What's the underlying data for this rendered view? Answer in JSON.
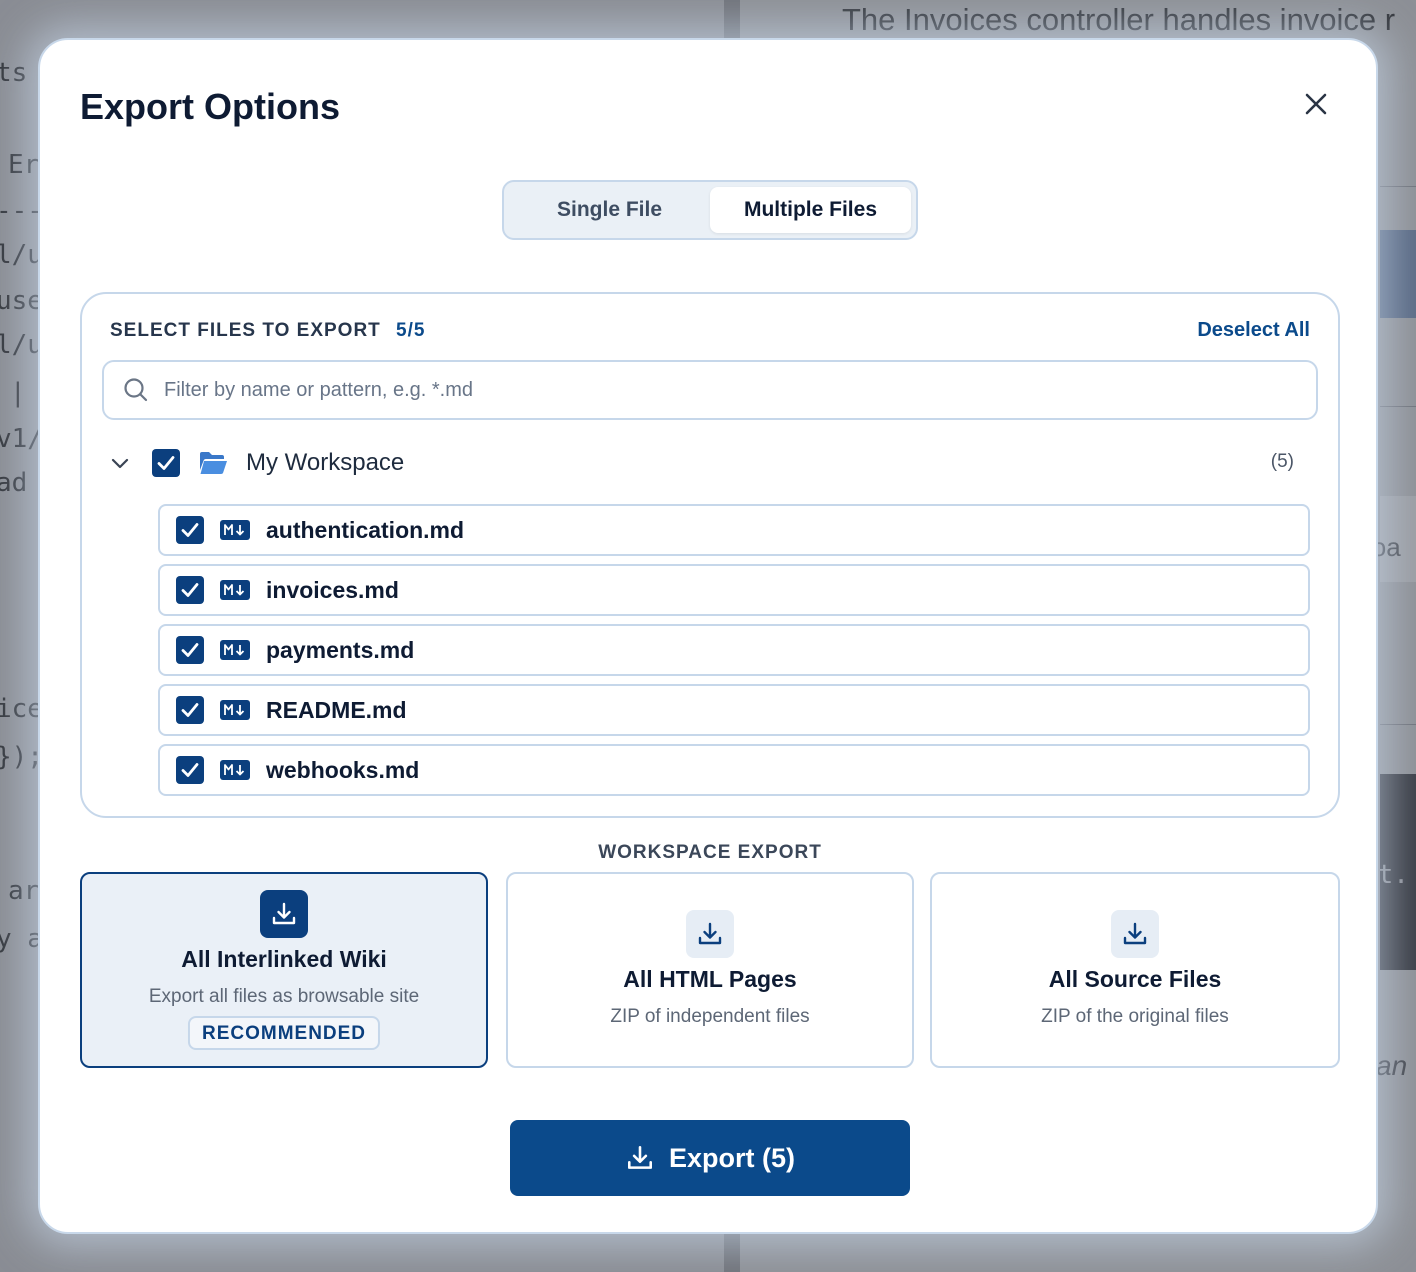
{
  "background": {
    "heading": "The Invoices controller handles invoice r",
    "code_lines": [
      "ts",
      "Er",
      "----",
      "l/u",
      "use",
      "l/u",
      "|",
      "v1/",
      "ad",
      "ice",
      "});",
      "ar",
      "y a"
    ],
    "right_fragments": [
      "loa",
      "nt.",
      "an"
    ]
  },
  "modal": {
    "title": "Export Options",
    "tabs": [
      {
        "label": "Single File",
        "active": false
      },
      {
        "label": "Multiple Files",
        "active": true
      }
    ],
    "file_panel": {
      "label": "SELECT FILES TO EXPORT",
      "count": "5/5",
      "deselect_label": "Deselect All",
      "search_placeholder": "Filter by name or pattern, e.g. *.md",
      "root": {
        "label": "My Workspace",
        "count": "(5)",
        "checked": true,
        "expanded": true
      },
      "files": [
        {
          "name": "authentication.md",
          "checked": true
        },
        {
          "name": "invoices.md",
          "checked": true
        },
        {
          "name": "payments.md",
          "checked": true
        },
        {
          "name": "README.md",
          "checked": true
        },
        {
          "name": "webhooks.md",
          "checked": true
        }
      ]
    },
    "workspace_export": {
      "label": "WORKSPACE EXPORT",
      "options": [
        {
          "title": "All Interlinked Wiki",
          "description": "Export all files as browsable site",
          "badge": "RECOMMENDED",
          "selected": true,
          "icon": "download-icon"
        },
        {
          "title": "All HTML Pages",
          "description": "ZIP of independent files",
          "selected": false,
          "icon": "download-icon"
        },
        {
          "title": "All Source Files",
          "description": "ZIP of the original files",
          "selected": false,
          "icon": "download-icon"
        }
      ]
    },
    "export_button": {
      "label": "Export (5)",
      "icon": "download-icon"
    }
  },
  "colors": {
    "primary": "#0b4a8b",
    "checkbox": "#0b3f7e",
    "border": "#c6d7ea",
    "title_text": "#0e1b33",
    "selected_card_bg": "#eaf0f7"
  }
}
